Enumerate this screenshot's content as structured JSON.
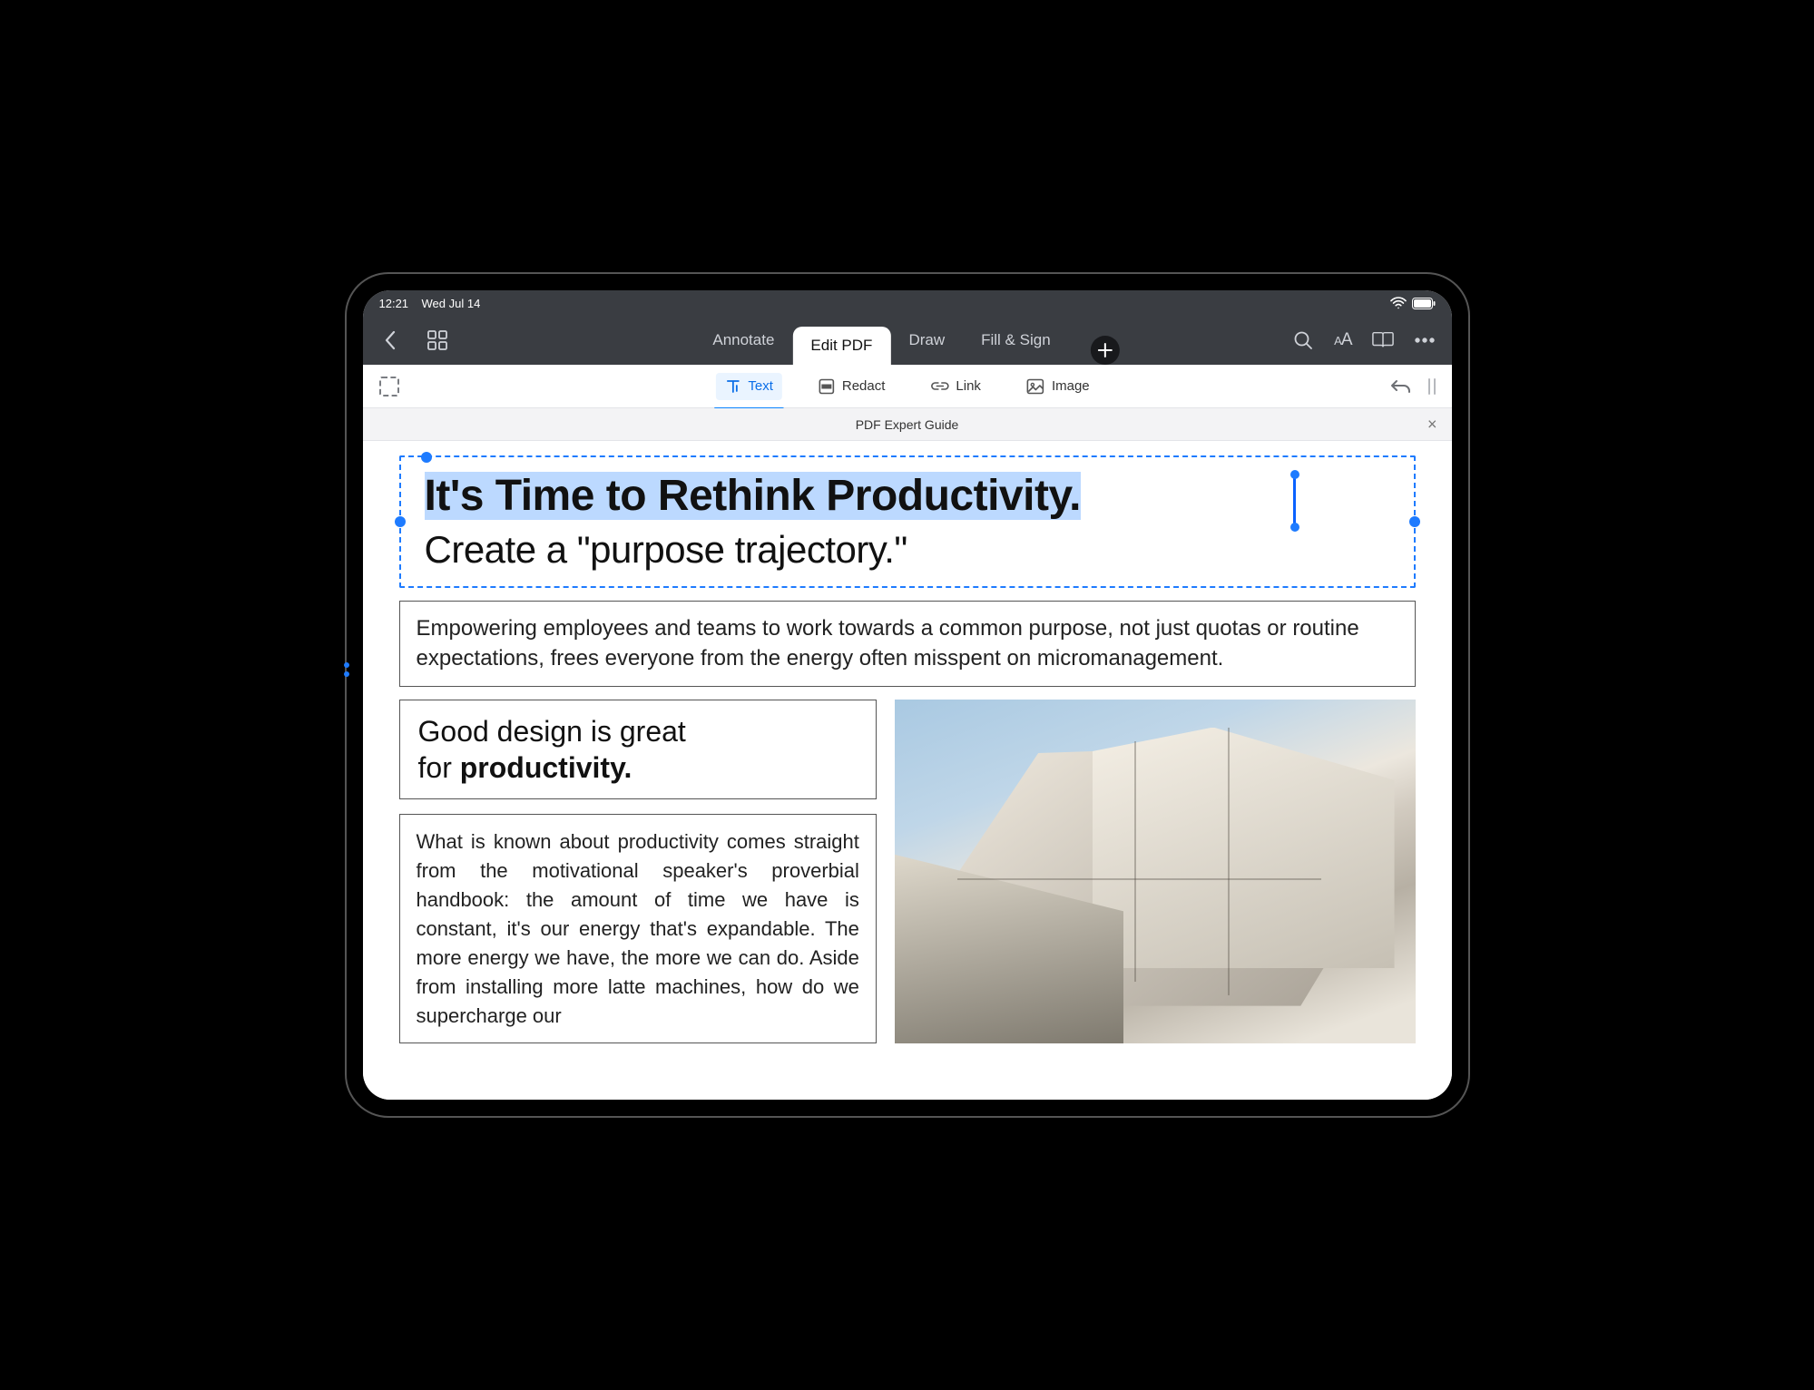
{
  "status": {
    "time": "12:21",
    "date": "Wed Jul 14"
  },
  "toolbar": {
    "tabs": [
      {
        "label": "Annotate",
        "active": false
      },
      {
        "label": "Edit PDF",
        "active": true
      },
      {
        "label": "Draw",
        "active": false
      },
      {
        "label": "Fill & Sign",
        "active": false
      }
    ]
  },
  "tools": [
    {
      "id": "text",
      "label": "Text",
      "active": true
    },
    {
      "id": "redact",
      "label": "Redact",
      "active": false
    },
    {
      "id": "link",
      "label": "Link",
      "active": false
    },
    {
      "id": "image",
      "label": "Image",
      "active": false
    }
  ],
  "doc_tab": {
    "title": "PDF Expert Guide"
  },
  "content": {
    "headline_selected": "It's Time to Rethink Productivity.",
    "subheadline": "Create a \"purpose trajectory.\"",
    "intro": "Empowering employees and teams to work towards a common purpose, not just quotas or routine expectations, frees everyone from the energy often misspent on micromanagement.",
    "design_line1": "Good design is great",
    "design_line2_pre": "for ",
    "design_line2_bold": "productivity.",
    "body": "What is known about productivity comes straight from the motivational speaker's proverbial handbook: the amount of time we have is constant, it's our energy that's expandable. The more energy we have, the more we can do. Aside from installing more latte machines, how do we supercharge our"
  }
}
